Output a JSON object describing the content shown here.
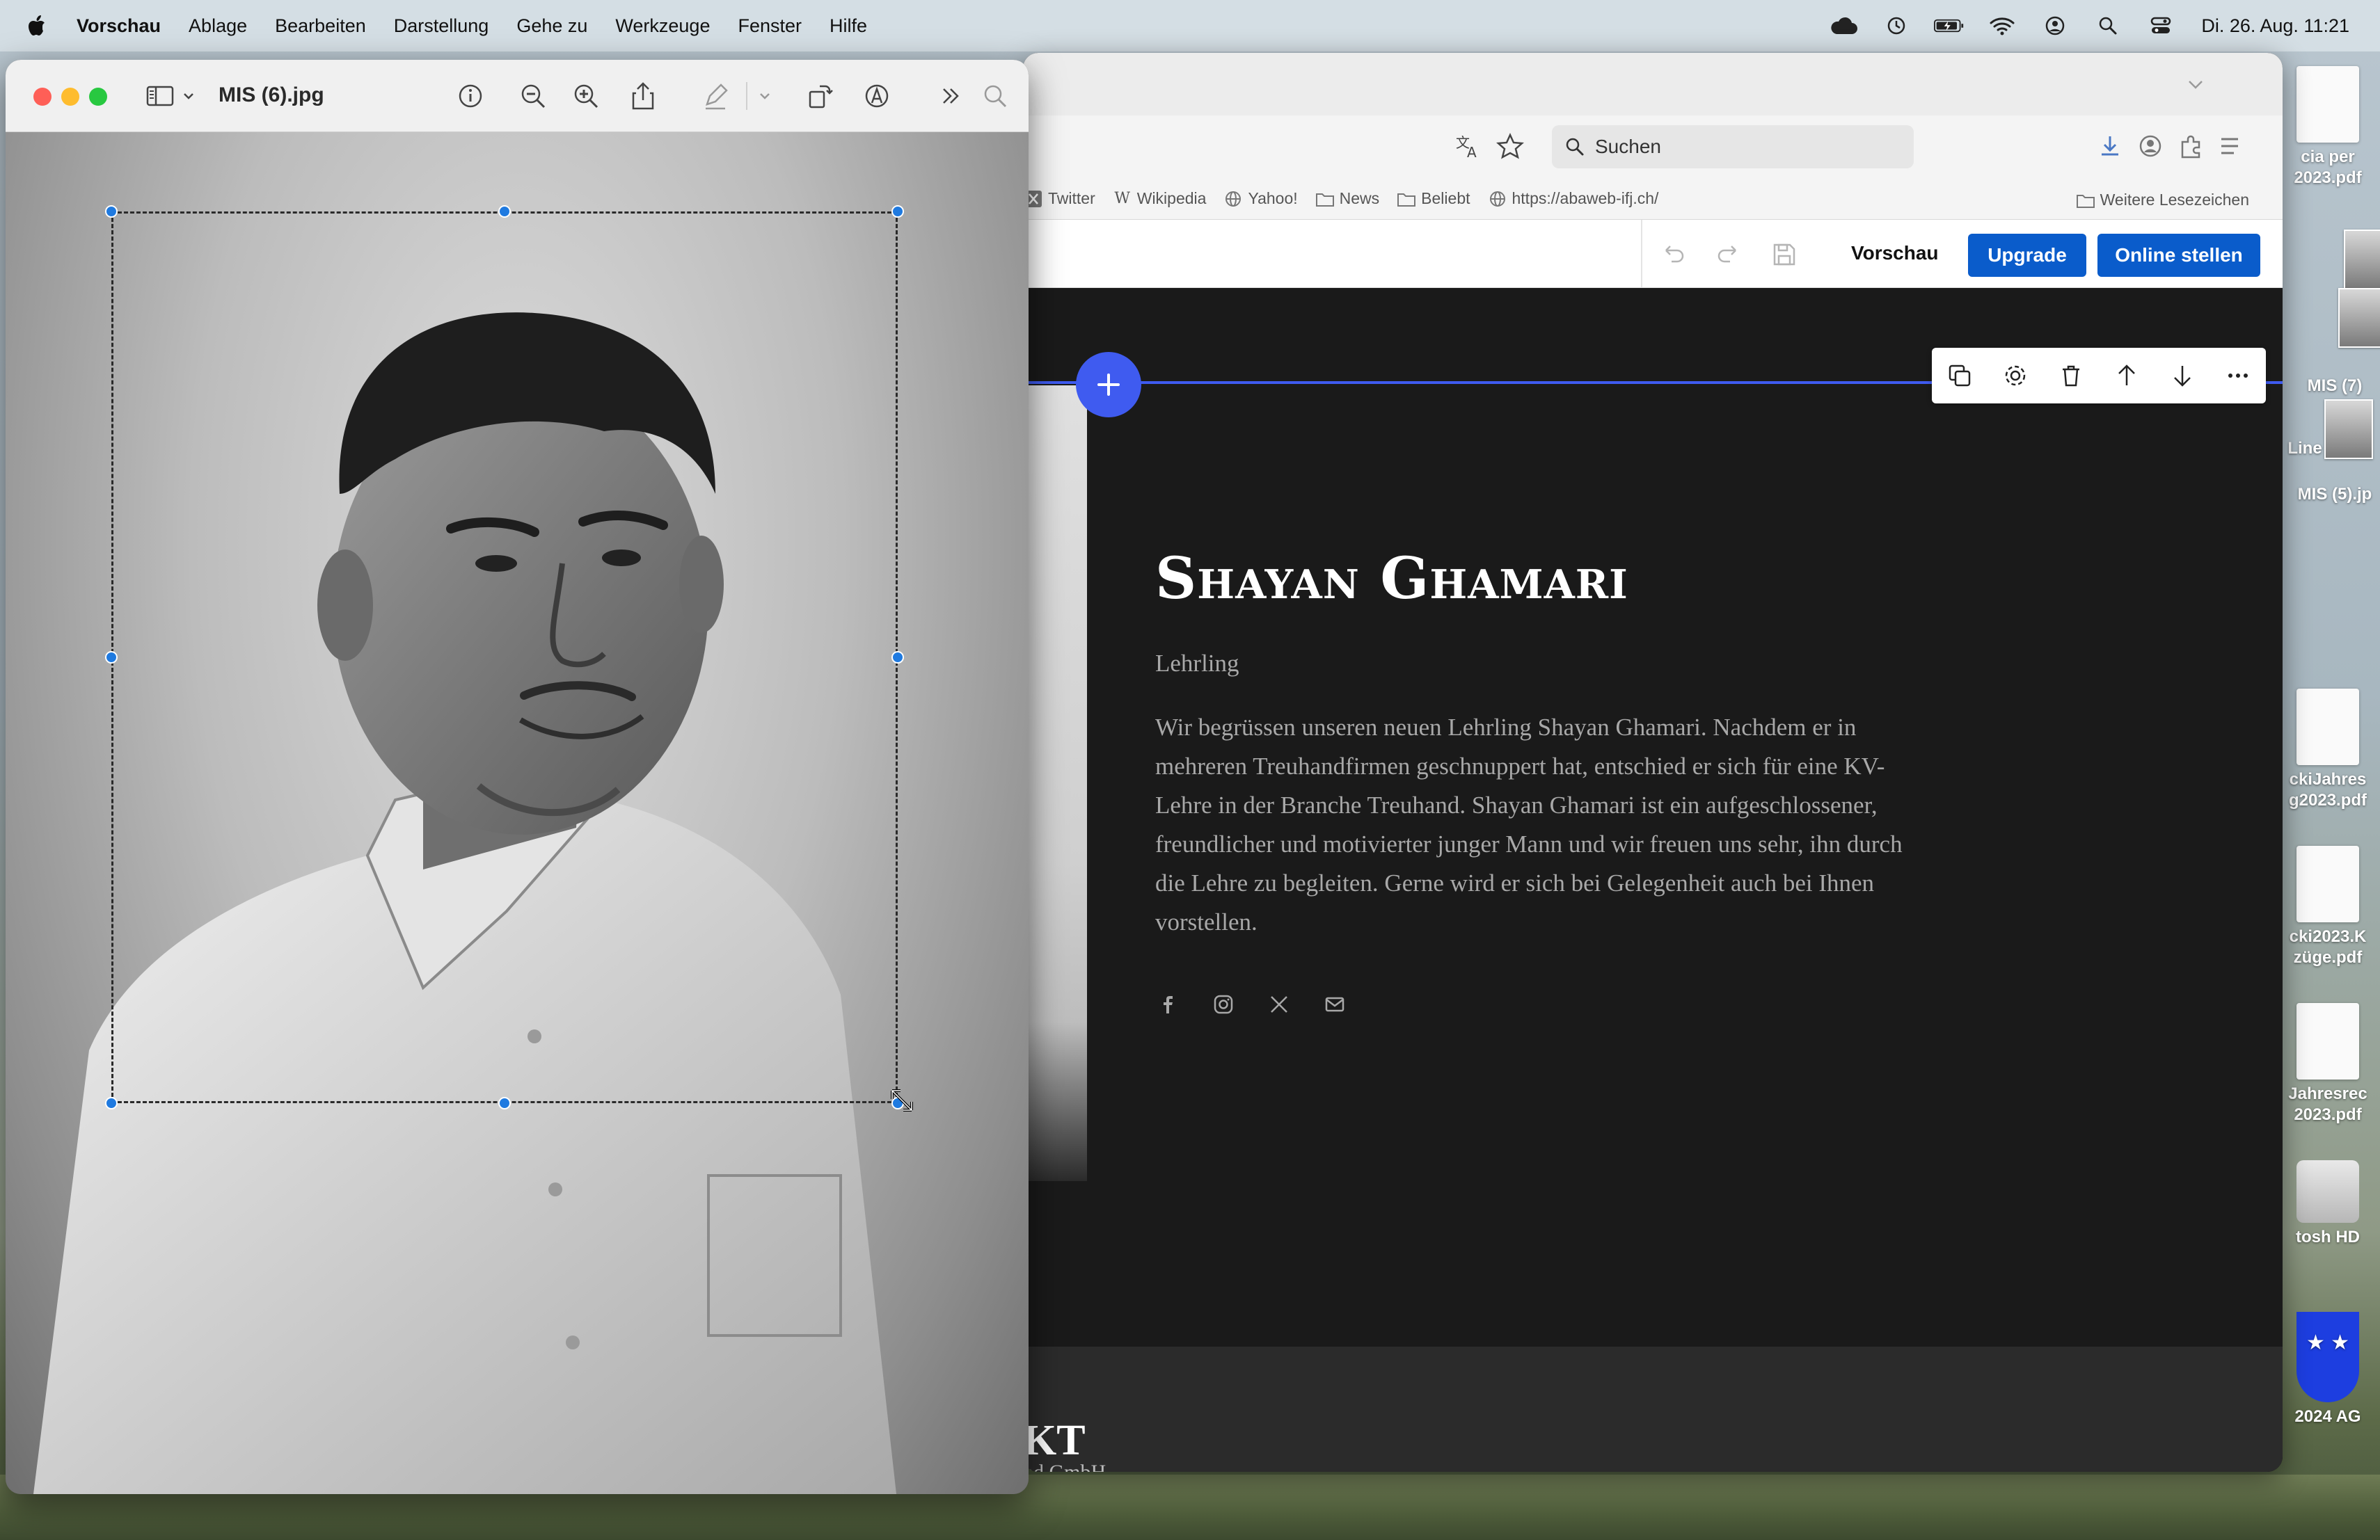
{
  "menubar": {
    "app_name": "Vorschau",
    "items": [
      "Ablage",
      "Bearbeiten",
      "Darstellung",
      "Gehe zu",
      "Werkzeuge",
      "Fenster",
      "Hilfe"
    ],
    "clock": "Di. 26. Aug.  11:21"
  },
  "preview": {
    "title": "MIS (6).jpg"
  },
  "browser": {
    "search_placeholder": "Suchen",
    "bookmarks": [
      "Twitter",
      "Wikipedia",
      "Yahoo!",
      "News",
      "Beliebt",
      "https://abaweb-ifj.ch/"
    ],
    "more_bookmarks": "Weitere Lesezeichen",
    "editor": {
      "preview_label": "Vorschau",
      "upgrade_label": "Upgrade",
      "publish_label": "Online stellen"
    },
    "profile": {
      "name": "Shayan Ghamari",
      "role": "Lehrling",
      "bio": "Wir begrüssen unseren neuen Lehrling Shayan Ghamari. Nachdem er in mehreren Treuhandfirmen geschnuppert hat, entschied er sich für eine KV-Lehre in der Branche Treuhand. Shayan Ghamari ist ein aufgeschlossener, freundlicher und motivierter junger Mann und wir freuen uns sehr, ihn durch die Lehre zu begleiten. Gerne wird er sich bei Gelegenheit auch bei Ihnen vorstellen."
    },
    "footer": {
      "title": "KT",
      "subtitle": "nd GmbH"
    }
  },
  "desktop": {
    "icons": [
      {
        "label1": "cia per",
        "label2": "2023.pdf"
      },
      {
        "label1": "MIS (7)",
        "label2": ""
      },
      {
        "label1": "Line",
        "label2": ""
      },
      {
        "label1": "MIS (5).jp",
        "label2": ""
      },
      {
        "label1": "ckiJahres",
        "label2": "g2023.pdf"
      },
      {
        "label1": "cki2023.K",
        "label2": "züge.pdf"
      },
      {
        "label1": "Jahresrec",
        "label2": "2023.pdf"
      },
      {
        "label1": "tosh HD",
        "label2": ""
      },
      {
        "label1": "2024 AG",
        "label2": ""
      }
    ]
  }
}
